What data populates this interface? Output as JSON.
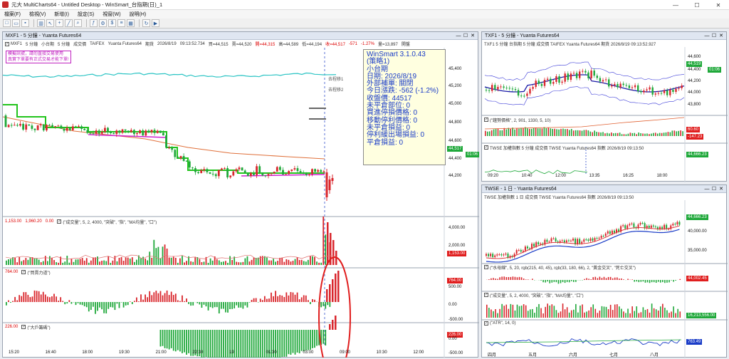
{
  "window": {
    "title": "元大 MultiCharts64 - Untitled Desktop - WinSmart_台指期(日)_1",
    "minimize": "—",
    "maximize": "☐",
    "close": "✕"
  },
  "menu": [
    "檔案(F)",
    "檢視(V)",
    "新增(I)",
    "設定(S)",
    "視窗(W)",
    "說明(H)"
  ],
  "left_panel": {
    "title": "MXF1 - 5 分鐘 - Yuanta Futures64",
    "info": {
      "symbol": "MXF1",
      "interval": "5 分鐘",
      "name": "小台期",
      "interval2": "5 分鐘",
      "type": "成交價",
      "exchange": "TAIFEX",
      "feed": "Yuanta Futures64",
      "kind": "期貨",
      "date": "2026/8/19",
      "time": "09:13:52.734",
      "buy": "買=44,515",
      "sell": "賣=44,520",
      "open": "開=44,315",
      "high": "高=44,589",
      "low": "低=44,194",
      "close": "收=44,517",
      "change": "-571",
      "change_pct": "-1.27%",
      "volume": "量=13,897",
      "tag": "開盤"
    },
    "notice": [
      "模擬訊號，請勿直接交易使用",
      "真實下單要有正式交易才能下單!"
    ],
    "markers": [
      "去程移1",
      "去程移2"
    ],
    "price_axis": [
      "45,400",
      "45,200",
      "45,000",
      "44,800",
      "44,600",
      "44,400",
      "44,200"
    ],
    "last_price": "44,517",
    "time_tag": "01:06",
    "vol_pane": {
      "left_value": "1,153.00",
      "left_value2": "1,960.20",
      "left_value3": "0.00",
      "label": "(\"成交量\", 5, 2, 4000, \"突破\", \"指\", \"MA均量\", \"口\")",
      "axis": [
        "4,000.00",
        "2,000.00"
      ],
      "tag": "1,153.00"
    },
    "pane2": {
      "left_value": "764.00",
      "label": "(\"買賣力道\")",
      "axis": [
        "500.00",
        "0.00",
        "-500.00"
      ],
      "tag": "764.00"
    },
    "pane3": {
      "left_value": "226.00",
      "label": "(\"大戶籌碼\")",
      "axis": [
        "0.00",
        "-500.00"
      ],
      "tag": "226.00"
    },
    "time_axis": [
      "15:20",
      "16:40",
      "18:00",
      "19:30",
      "21:00",
      "22:30",
      "19",
      "01:30",
      "03:00",
      "09:00",
      "10:30",
      "12:00"
    ]
  },
  "infobox": {
    "lines": [
      "WinSmart 3.1.0.43",
      "(策略1)",
      "小台期",
      "日期: 2026/8/19",
      "外部補單: 關閉",
      "今日漲跌: -562 (-1.2%)",
      "收盤價: 44517",
      "未平倉部位: 0",
      "買進停損價格: 0",
      "移動停利價格: 0",
      "未平倉損益: 0",
      "停利緩出場損益: 0",
      "平倉損益: 0"
    ]
  },
  "top_right_panel": {
    "title": "TXF1 - 5 分鐘 - Yuanta Futures64",
    "info": "TXF1  5 分鐘  台指期  5 分鐘  成交價  TAIFEX  Yuanta Futures64  期貨  2026/8/19  09:13:52.927",
    "price_axis": [
      "44,600",
      "44,400",
      "44,200",
      "44,000",
      "43,800"
    ],
    "last_price": "44,519",
    "time_tag": "01:06",
    "pane2": {
      "label": "(\"趨勢價格\", 2, 901, 1330, 5, 10)",
      "tag1": "60.60",
      "tag2": "-147.23"
    },
    "pane3": {
      "info": "TWSE  加權指數  5 分鐘  成交價  TWSE  Yuanta Futures64  指數  2026/8/19  09:13:50",
      "tag": "44,666.23"
    },
    "time_axis": [
      "09:20",
      "10:40",
      "12:00",
      "13:35",
      "16:25",
      "18:00"
    ]
  },
  "bottom_right_panel": {
    "title": "TWSE - 1 日 - Yuanta Futures64",
    "info": "TWSE  加權指數  1 日  成交價  TWSE  Yuanta Futures64  指數  2026/8/19  09:13:50",
    "price_axis": [
      "40,000.00",
      "35,000.00"
    ],
    "last_price": "44,666.23",
    "pane2": {
      "label": "(\"水母線\", 5, 20, rgb(215, 40, 45), rgb(33, 180, 66), 2, \"黃金交叉\", \"死亡交叉\")",
      "tag": "44,002.45"
    },
    "pane3": {
      "label": "(\"成交量\", 5, 2, 4000, \"突破\", \"指\", \"MA均量\", \"口\")",
      "tag": "16,213,556.00"
    },
    "pane4": {
      "label": "(\"ATR\", 14, 0)",
      "tag": "763.49"
    },
    "time_axis": [
      "四月",
      "五月",
      "六月",
      "七月",
      "八月"
    ]
  },
  "colors": {
    "up": "#d9262c",
    "down": "#1fa83a",
    "accent_blue": "#1a3cc7",
    "tag_red": "#e01e1e",
    "tag_green": "#16a34a"
  }
}
